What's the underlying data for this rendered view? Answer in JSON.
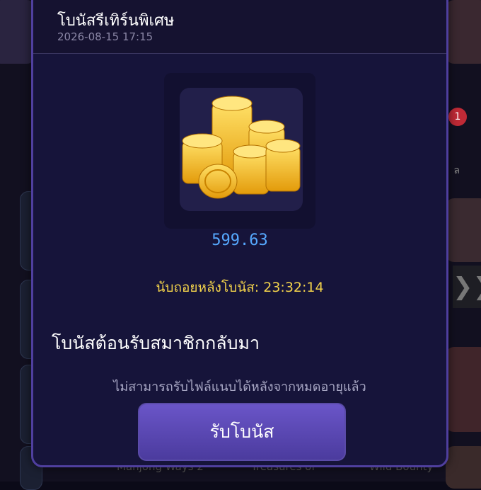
{
  "background": {
    "badge_count": "1",
    "right_label": "ล",
    "arrow": "❯❯",
    "bottom_labels": [
      "Mahjong Ways 2",
      "Treasures of",
      "Wild Bounty"
    ]
  },
  "modal": {
    "title": "โบนัสรีเทิร์นพิเศษ",
    "date": "2026-08-15 17:15",
    "amount": "599.63",
    "countdown_label": "นับถอยหลังโบนัส:",
    "countdown_time": "23:32:14",
    "welcome_text": "โบนัสต้อนรับสมาชิกกลับมา",
    "note": "ไม่สามารถรับไฟล์แนบได้หลังจากหมดอายุแล้ว",
    "claim_label": "รับโบนัส"
  },
  "colors": {
    "accent": "#5a4ba8",
    "amount": "#56a9ff",
    "countdown": "#f2d24b"
  }
}
